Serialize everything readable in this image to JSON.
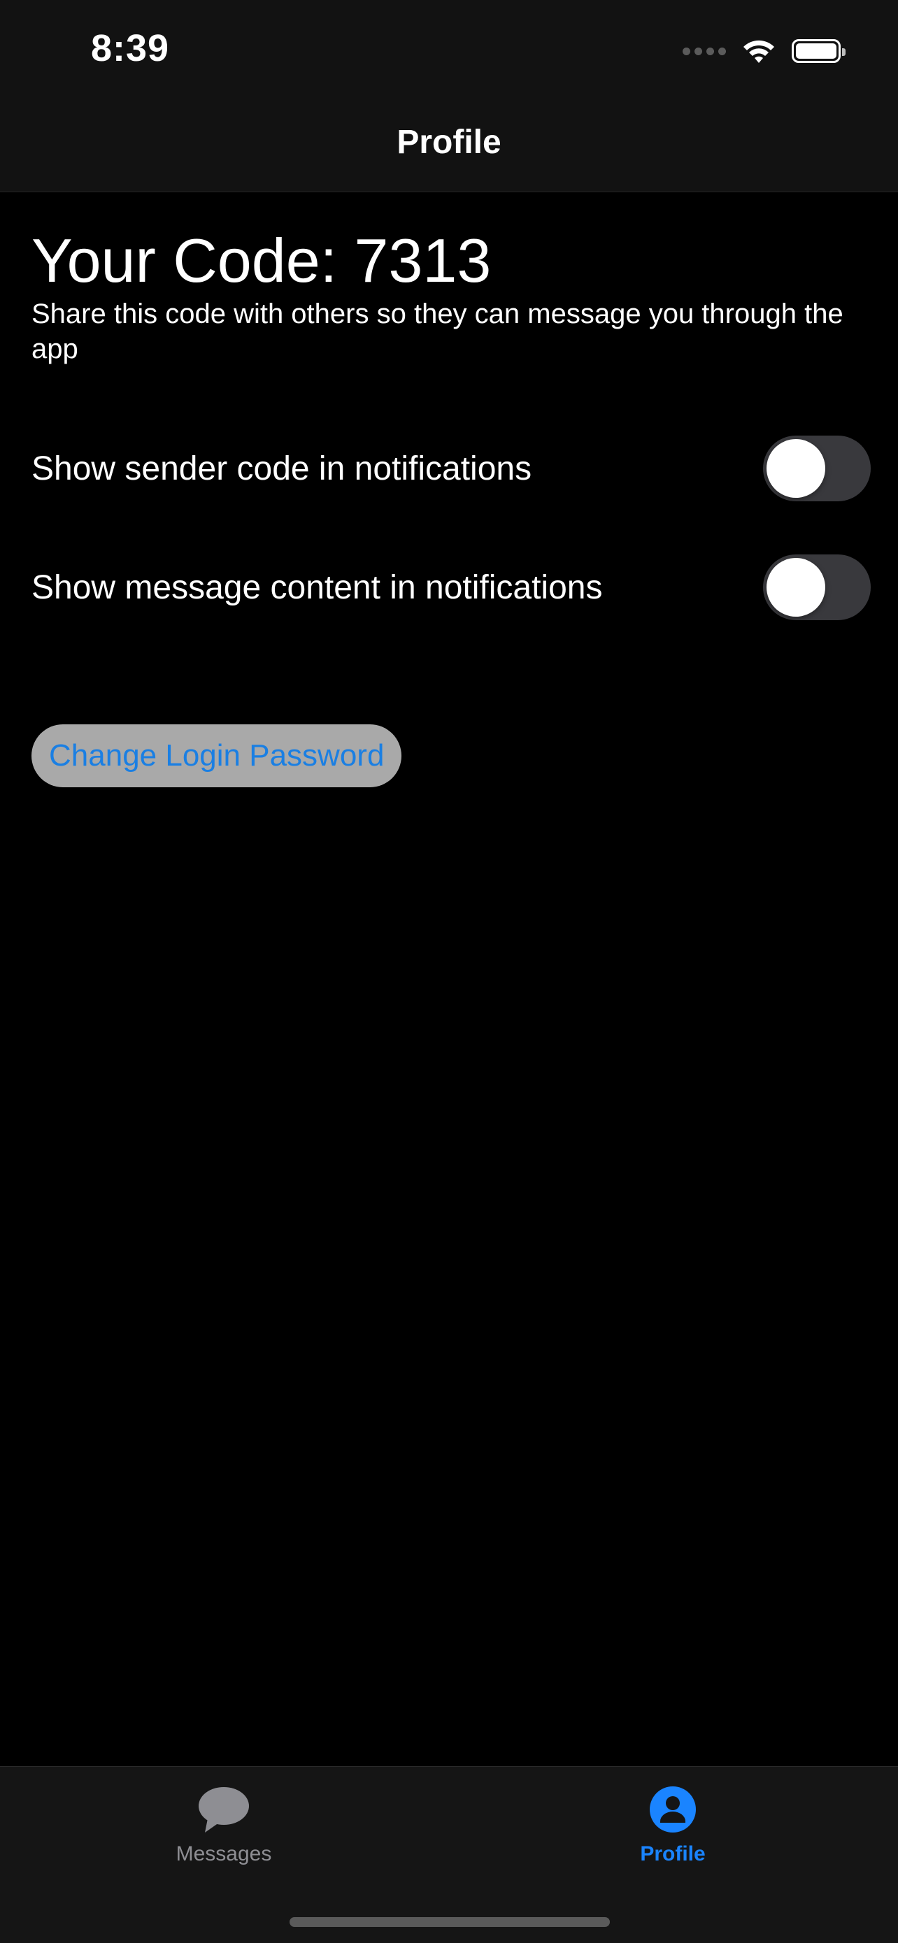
{
  "status_bar": {
    "time": "8:39"
  },
  "nav": {
    "title": "Profile"
  },
  "profile": {
    "code_heading": "Your Code: 7313",
    "code_description": "Share this code with others so they can message you through the app"
  },
  "settings": [
    {
      "label": "Show sender code in notifications",
      "enabled": false
    },
    {
      "label": "Show message content in notifications",
      "enabled": false
    }
  ],
  "actions": {
    "change_password_label": "Change Login Password"
  },
  "tab_bar": {
    "tabs": [
      {
        "label": "Messages",
        "icon": "chat-bubble-icon",
        "selected": false
      },
      {
        "label": "Profile",
        "icon": "person-circle-icon",
        "selected": true
      }
    ]
  },
  "colors": {
    "accent": "#1a84ff",
    "background": "#000000",
    "toggle_off": "#39393d",
    "button_background": "#a9a9a9"
  }
}
